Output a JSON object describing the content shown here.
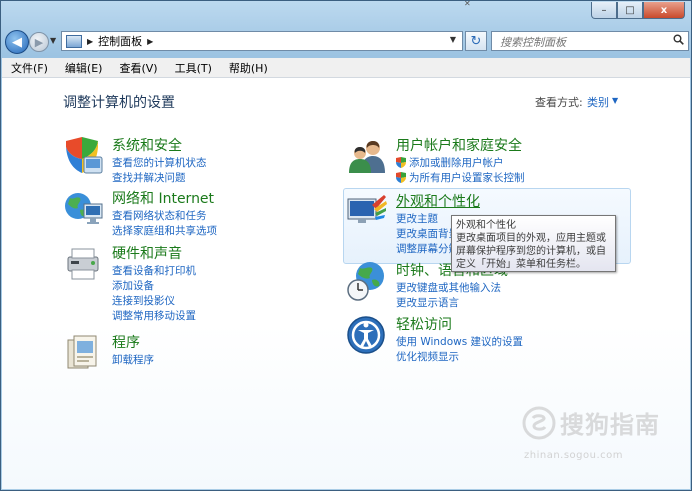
{
  "window": {
    "minimize_label": "–",
    "maximize_label": "□",
    "close_label": "x"
  },
  "address": {
    "path": "控制面板",
    "search_placeholder": "搜索控制面板"
  },
  "menubar": {
    "items": [
      "文件(F)",
      "编辑(E)",
      "查看(V)",
      "工具(T)",
      "帮助(H)"
    ]
  },
  "header": {
    "title": "调整计算机的设置",
    "view_by_label": "查看方式:",
    "view_by_value": "类别"
  },
  "categories": [
    {
      "title": "系统和安全",
      "icon": "system-security-icon",
      "links": [
        "查看您的计算机状态",
        "查找并解决问题"
      ]
    },
    {
      "title": "网络和 Internet",
      "icon": "network-internet-icon",
      "links": [
        "查看网络状态和任务",
        "选择家庭组和共享选项"
      ]
    },
    {
      "title": "硬件和声音",
      "icon": "hardware-sound-icon",
      "links": [
        "查看设备和打印机",
        "添加设备",
        "连接到投影仪",
        "调整常用移动设置"
      ]
    },
    {
      "title": "程序",
      "icon": "programs-icon",
      "links": [
        "卸载程序"
      ]
    },
    {
      "title": "用户帐户和家庭安全",
      "icon": "user-accounts-icon",
      "links": [
        "添加或删除用户帐户",
        "为所有用户设置家长控制"
      ]
    },
    {
      "title": "外观和个性化",
      "icon": "appearance-icon",
      "links": [
        "更改主题",
        "更改桌面背景",
        "调整屏幕分辨率"
      ]
    },
    {
      "title": "时钟、语言和区域",
      "icon": "clock-region-icon",
      "links": [
        "更改键盘或其他输入法",
        "更改显示语言"
      ]
    },
    {
      "title": "轻松访问",
      "icon": "ease-of-access-icon",
      "links": [
        "使用 Windows 建议的设置",
        "优化视频显示"
      ]
    }
  ],
  "tooltip": {
    "title": "外观和个性化",
    "body": "更改桌面项目的外观，应用主题或屏幕保护程序到您的计算机，或自定义「开始」菜单和任务栏。"
  },
  "watermark": {
    "text": "搜狗指南",
    "url": "zhinan.sogou.com"
  },
  "colors": {
    "category_title": "#1b7a1b",
    "link": "#1e66c2",
    "page_title": "#1e395b"
  }
}
